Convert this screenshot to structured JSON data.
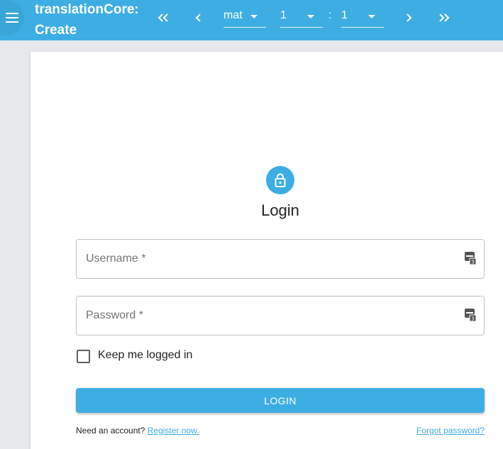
{
  "header": {
    "title": "translationCore: Create",
    "menu_icon": "menu-icon",
    "nav": {
      "first": "double-chevron-left-icon",
      "prev": "chevron-left-icon",
      "next": "chevron-right-icon",
      "last": "double-chevron-right-icon"
    },
    "book": {
      "value": "mat"
    },
    "chapter": {
      "value": "1"
    },
    "separator": ":",
    "verse": {
      "value": "1"
    }
  },
  "login": {
    "icon": "lock-icon",
    "title": "Login",
    "username_placeholder": "Username *",
    "password_placeholder": "Password *",
    "field_icon": "password-manager-key-icon",
    "keep_logged_in": {
      "label": "Keep me logged in",
      "checked": false
    },
    "button_label": "LOGIN",
    "need_account_text": "Need an account?",
    "register_link": "Register now.",
    "forgot_link": "Forgot password?"
  },
  "colors": {
    "primary": "#3daee3",
    "background": "#e6e8eb",
    "card": "#ffffff"
  }
}
